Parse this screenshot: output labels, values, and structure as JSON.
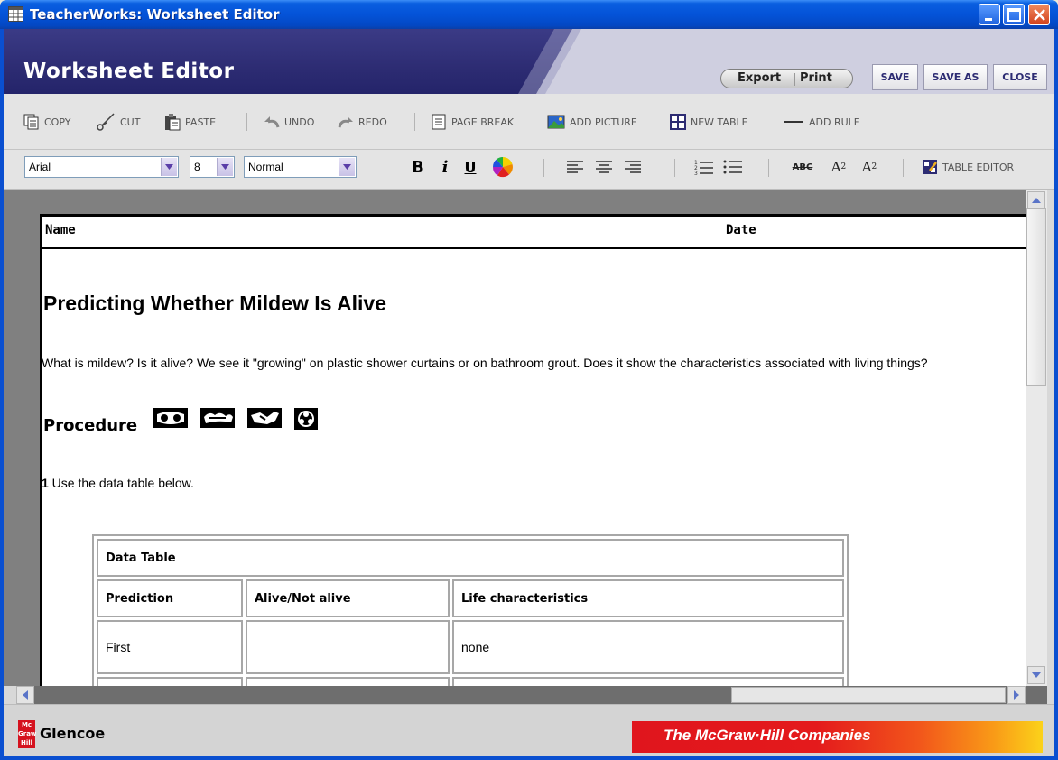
{
  "window": {
    "title": "TeacherWorks: Worksheet Editor"
  },
  "header": {
    "title": "Worksheet Editor",
    "export_label": "Export",
    "print_label": "Print",
    "save_label": "SAVE",
    "save_as_label": "SAVE AS",
    "close_label": "CLOSE"
  },
  "toolbar": {
    "copy": "COPY",
    "cut": "CUT",
    "paste": "PASTE",
    "undo": "UNDO",
    "redo": "REDO",
    "page_break": "PAGE BREAK",
    "add_picture": "ADD PICTURE",
    "new_table": "NEW TABLE",
    "add_rule": "ADD RULE"
  },
  "format": {
    "font": "Arial",
    "size": "8",
    "style": "Normal",
    "bold": "B",
    "italic": "i",
    "underline": "U",
    "strike": "ABC",
    "superscript": "A",
    "superscript_mark": "2",
    "subscript": "A",
    "subscript_mark": "2",
    "table_editor": "TABLE EDITOR"
  },
  "document": {
    "name_label": "Name",
    "date_label": "Date",
    "title": "Predicting Whether Mildew Is Alive",
    "intro": "What is mildew? Is it alive? We see it \"growing\" on plastic shower curtains or on bathroom grout. Does it show the characteristics associated with living things?",
    "procedure_heading": "Procedure",
    "step_number": "1",
    "step_text": " Use the data table below.",
    "table": {
      "caption": "Data Table",
      "headers": [
        "Prediction",
        "Alive/Not alive",
        "Life characteristics"
      ],
      "rows": [
        [
          "First",
          "",
          "none"
        ],
        [
          "",
          "",
          ""
        ]
      ]
    }
  },
  "footer": {
    "glencoe": "Glencoe",
    "mh_logo": "Mc Graw Hill",
    "mcgraw_brand": "The McGraw·Hill Companies"
  }
}
